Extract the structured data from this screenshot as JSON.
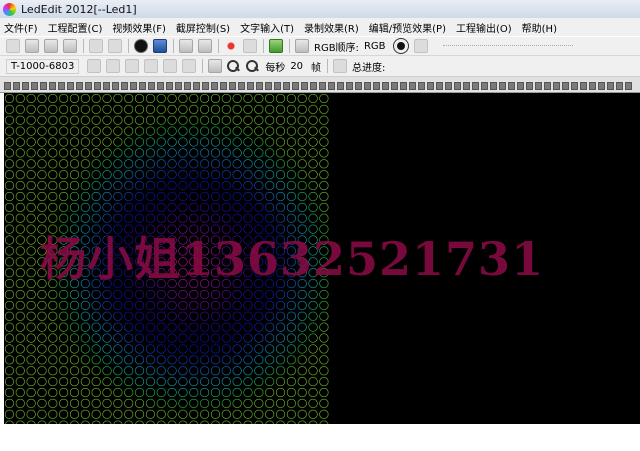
{
  "window": {
    "title": "LedEdit 2012[--Led1]"
  },
  "menu": [
    "文件(F)",
    "工程配置(C)",
    "视频效果(F)",
    "截屏控制(S)",
    "文字输入(T)",
    "录制效果(R)",
    "编辑/预览效果(P)",
    "工程输出(O)",
    "帮助(H)"
  ],
  "toolbar": {
    "rgb_order_label": "RGB顺序:",
    "rgb_order_value": "RGB",
    "project_id": "T-1000-6803",
    "per_second_label": "每秒",
    "fps_value": "20",
    "frame_unit": "帧",
    "progress_label": "总进度:"
  },
  "canvas": {
    "watermark": "杨小姐13632521731"
  },
  "icons": {
    "new": "new-file-icon",
    "open": "open-folder-icon",
    "save": "save-icon",
    "record": "record-icon",
    "play": "play-icon",
    "stop": "stop-icon",
    "zoom_in": "zoom-in-icon",
    "zoom_out": "zoom-out-icon"
  }
}
